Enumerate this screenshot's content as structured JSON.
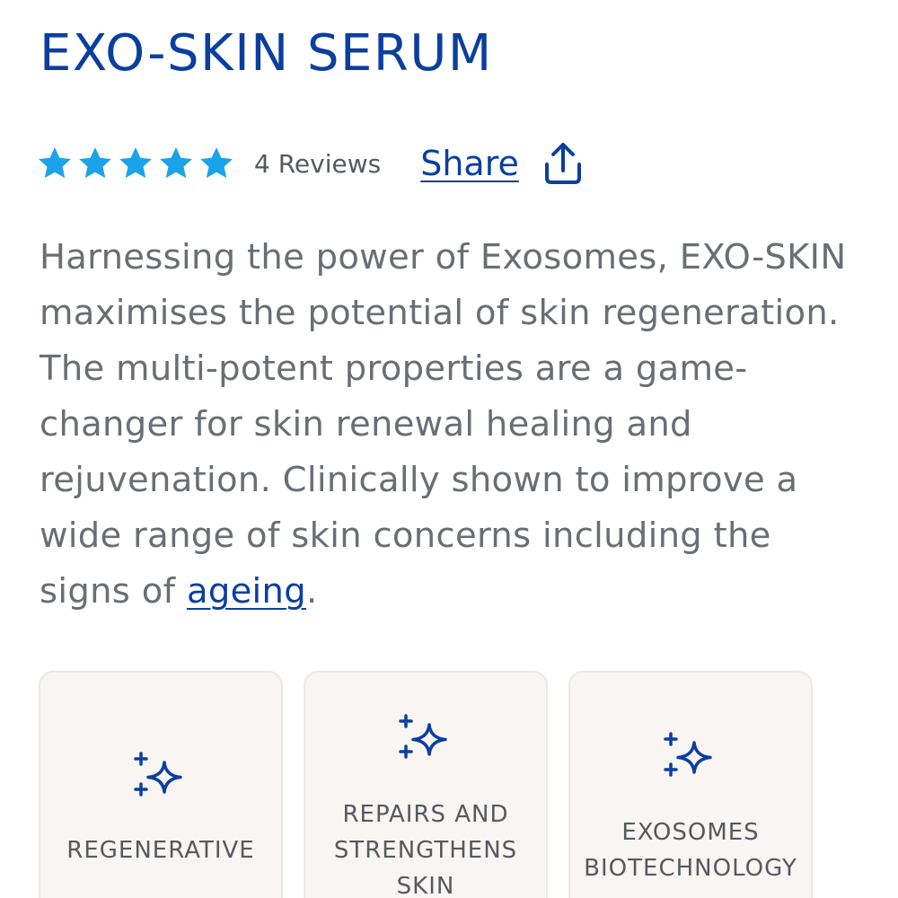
{
  "product": {
    "title": "EXO-SKIN SERUM",
    "rating": 5,
    "rating_max": 5,
    "reviews_label": "4 Reviews",
    "share_label": "Share"
  },
  "description": {
    "text_before_link": "Harnessing the power of Exosomes, EXO-SKIN maximises the potential of skin regeneration. The multi-potent properties are a game-changer for skin renewal healing and rejuvenation. Clinically shown to improve a wide range of skin concerns including the signs of ",
    "link_text": "ageing",
    "text_after_link": "."
  },
  "features": [
    {
      "icon": "sparkle-icon",
      "label_lines": [
        "REGENERATIVE"
      ]
    },
    {
      "icon": "sparkle-icon",
      "label_lines": [
        "REPAIRS AND",
        "STRENGTHENS",
        "SKIN"
      ]
    },
    {
      "icon": "sparkle-icon",
      "label_lines": [
        "EXOSOMES",
        "BIOTECHNOLOGY"
      ]
    }
  ],
  "colors": {
    "brand_blue": "#0a3fa0",
    "star": "#1aa3e8",
    "body_text": "#6a6e74",
    "card_bg": "#f8f5f3"
  }
}
